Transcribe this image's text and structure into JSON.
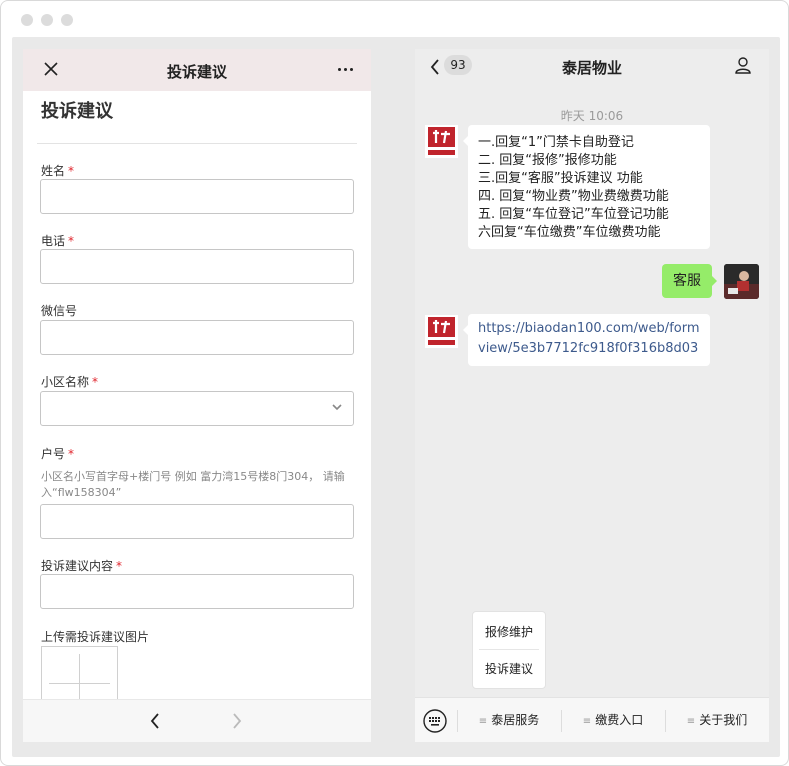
{
  "left": {
    "title": "投诉建议",
    "form_title": "投诉建议",
    "fields": [
      {
        "label": "姓名",
        "required": "*"
      },
      {
        "label": "电话",
        "required": "*"
      },
      {
        "label": "微信号"
      },
      {
        "label": "小区名称",
        "required": "*"
      },
      {
        "label": "户号",
        "required": "*",
        "hint_line1": "小区名小写首字母+楼门号 例如 富力湾15号楼8门304， 请输",
        "hint_line2": "入“flw158304”"
      },
      {
        "label": "投诉建议内容",
        "required": "*"
      },
      {
        "label": "上传需投诉建议图片"
      }
    ]
  },
  "chat": {
    "unread": "93",
    "title": "泰居物业",
    "timestamp": "昨天 10:06",
    "menu_lines": [
      "一.回复“1”门禁卡自助登记",
      "二. 回复“报修”报修功能",
      "三.回复“客服”投诉建议 功能",
      "四. 回复“物业费”物业费缴费功能",
      " 五. 回复“车位登记”车位登记功能",
      " 六回复“车位缴费”车位缴费功能"
    ],
    "my_message": "客服",
    "link_line1": "https://biaodan100.com/web/form",
    "link_line2": "view/5e3b7712fc918f0f316b8d03",
    "popup_items": [
      "报修维护",
      "投诉建议"
    ],
    "bottom_menu": [
      "泰居服务",
      "缴费入口",
      "关于我们"
    ]
  },
  "colors": {
    "required": "#e0252c",
    "my_bubble": "#95ec69",
    "link": "#3d5a8c",
    "header_tint": "#f1e8e9"
  }
}
